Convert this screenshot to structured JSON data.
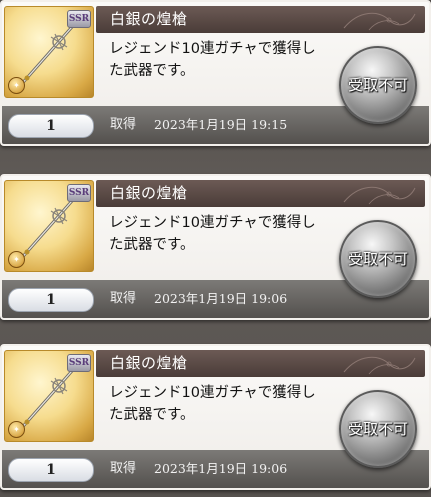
{
  "rewards": [
    {
      "name": "白銀の煌槍",
      "rarity": "SSR",
      "description": "レジェンド10連ガチャで獲得した武器です。",
      "quantity": "1",
      "acquired_label": "取得",
      "acquired_date": "2023年1月19日  19:15",
      "status": "受取不可"
    },
    {
      "name": "白銀の煌槍",
      "rarity": "SSR",
      "description": "レジェンド10連ガチャで獲得した武器です。",
      "quantity": "1",
      "acquired_label": "取得",
      "acquired_date": "2023年1月19日  19:06",
      "status": "受取不可"
    },
    {
      "name": "白銀の煌槍",
      "rarity": "SSR",
      "description": "レジェンド10連ガチャで獲得した武器です。",
      "quantity": "1",
      "acquired_label": "取得",
      "acquired_date": "2023年1月19日  19:06",
      "status": "受取不可"
    }
  ],
  "icons": {
    "thumbnail": "spear-icon",
    "element": "light-element-icon",
    "ornament": "filigree-ornament-icon"
  },
  "colors": {
    "title_bar": "#4a3c38",
    "info_bar": "#514e4b",
    "thumbnail_gold": "#f6dc8e",
    "button_silver": "#8d8d8d"
  }
}
